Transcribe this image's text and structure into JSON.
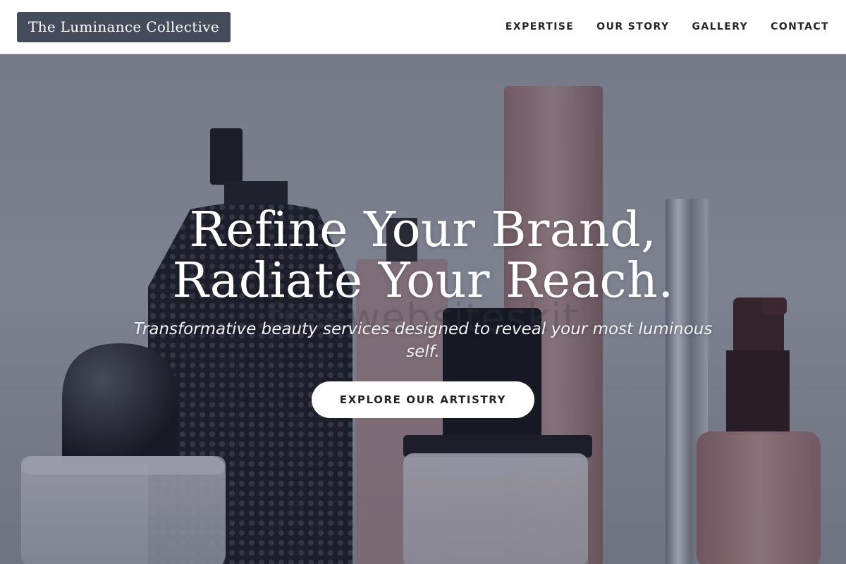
{
  "header": {
    "brand": "The Luminance Collective",
    "nav": [
      {
        "label": "EXPERTISE"
      },
      {
        "label": "OUR STORY"
      },
      {
        "label": "GALLERY"
      },
      {
        "label": "CONTACT"
      }
    ]
  },
  "hero": {
    "headline_line1": "Refine Your Brand,",
    "headline_line2": "Radiate Your Reach.",
    "subtitle": "Transformative beauty services designed to reveal your most luminous self.",
    "cta_label": "EXPLORE OUR ARTISTRY",
    "watermark": "freewebsiteskit",
    "background_image": "perfume-and-cosmetic-bottles"
  },
  "colors": {
    "brand_bg": "#444c5b",
    "nav_text": "#23252b",
    "hero_text": "#ffffff",
    "cta_bg": "#ffffff"
  }
}
